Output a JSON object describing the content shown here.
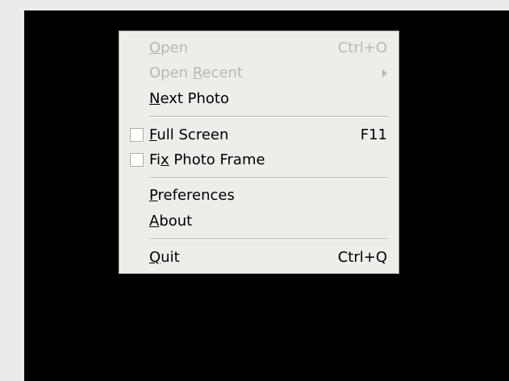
{
  "menu": {
    "open": {
      "prefix": "",
      "mnemonic": "O",
      "suffix": "pen",
      "accel": "Ctrl+O",
      "enabled": false
    },
    "open_recent": {
      "prefix": "Open ",
      "mnemonic": "R",
      "suffix": "ecent",
      "enabled": false,
      "submenu": true
    },
    "next_photo": {
      "prefix": "",
      "mnemonic": "N",
      "suffix": "ext Photo",
      "enabled": true
    },
    "full_screen": {
      "prefix": "",
      "mnemonic": "F",
      "suffix": "ull Screen",
      "accel": "F11",
      "enabled": true,
      "checked": false
    },
    "fix_photo_frame": {
      "prefix": "Fi",
      "mnemonic": "x",
      "suffix": " Photo Frame",
      "enabled": true,
      "checked": false
    },
    "preferences": {
      "prefix": "",
      "mnemonic": "P",
      "suffix": "references",
      "enabled": true
    },
    "about": {
      "prefix": "",
      "mnemonic": "A",
      "suffix": "bout",
      "enabled": true
    },
    "quit": {
      "prefix": "",
      "mnemonic": "Q",
      "suffix": "uit",
      "accel": "Ctrl+Q",
      "enabled": true
    }
  },
  "colors": {
    "canvas_background": "#000000",
    "menu_background": "#eeedea",
    "disabled_text": "#b8b7b1",
    "window_background": "#ebebe9"
  }
}
